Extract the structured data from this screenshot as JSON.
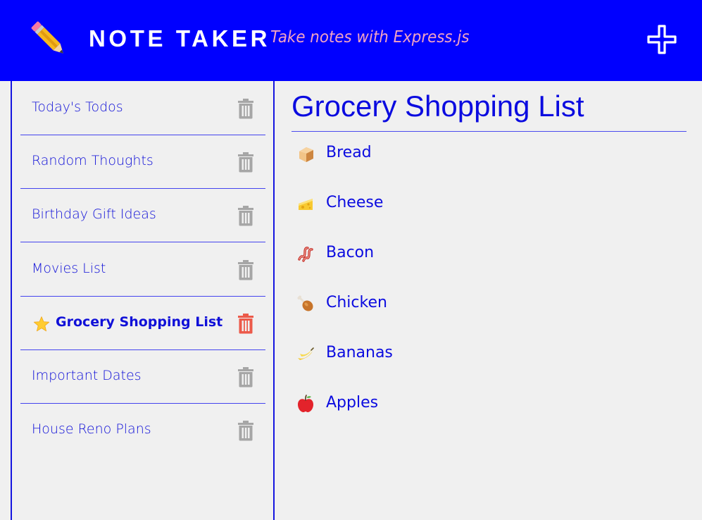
{
  "header": {
    "title": "NOTE TAKER",
    "tagline": "Take notes with Express.js",
    "logo_icon": "pencil-icon",
    "add_icon": "plus-icon"
  },
  "sidebar": {
    "notes": [
      {
        "label": "Today's Todos",
        "active": false
      },
      {
        "label": "Random Thoughts",
        "active": false
      },
      {
        "label": "Birthday Gift Ideas",
        "active": false
      },
      {
        "label": "Movies List",
        "active": false
      },
      {
        "label": "Grocery Shopping List",
        "active": true
      },
      {
        "label": "Important Dates",
        "active": false
      },
      {
        "label": "House Reno Plans",
        "active": false
      }
    ],
    "active_marker_icon": "star-icon",
    "delete_icon": "trash-icon"
  },
  "note": {
    "title": "Grocery Shopping List",
    "items": [
      {
        "label": "Bread",
        "icon": "bread-icon"
      },
      {
        "label": "Cheese",
        "icon": "cheese-icon"
      },
      {
        "label": "Bacon",
        "icon": "bacon-icon"
      },
      {
        "label": "Chicken",
        "icon": "chicken-leg-icon"
      },
      {
        "label": "Bananas",
        "icon": "banana-icon"
      },
      {
        "label": "Apples",
        "icon": "apple-icon"
      }
    ]
  },
  "colors": {
    "header_bg": "#0000ff",
    "text_blue": "#0b0be0",
    "tagline": "#f2a3c2",
    "trash_gray": "#a6a6a6",
    "trash_active": "#ec5a4a",
    "page_bg": "#f0f0f0"
  }
}
